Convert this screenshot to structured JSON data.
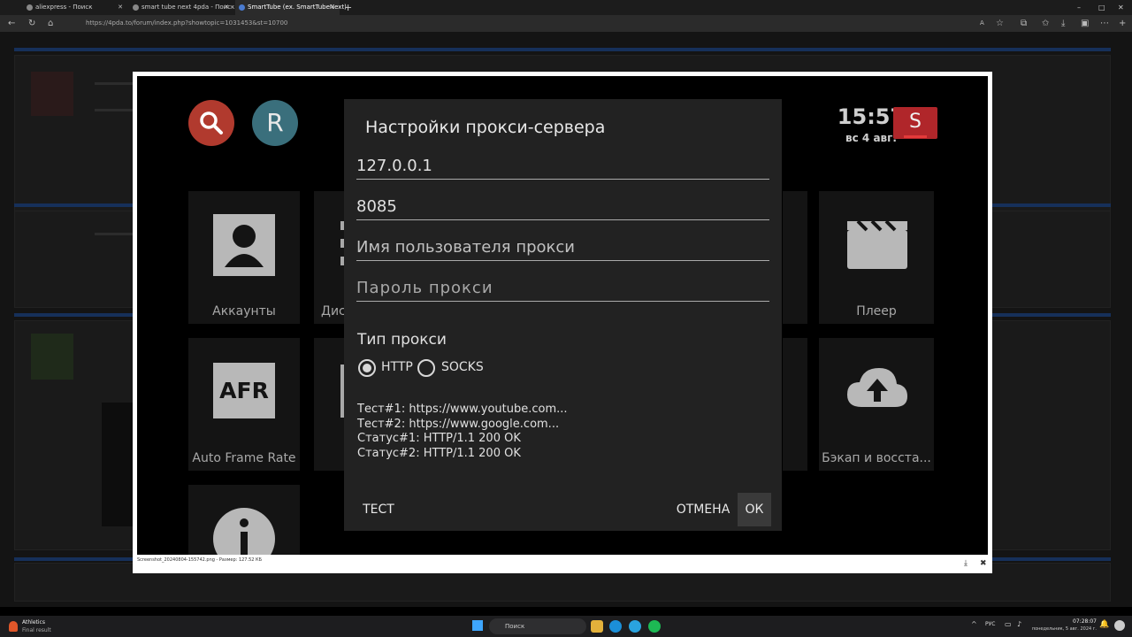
{
  "browser": {
    "tabs": [
      {
        "label": "aliexpress - Поиск",
        "active": false
      },
      {
        "label": "smart tube next 4pda - Поиск",
        "active": false
      },
      {
        "label": "SmartTube (ex. SmartTubeNext)",
        "active": true
      }
    ],
    "new_tab": "+",
    "url": "https://4pda.to/forum/index.php?showtopic=1031453&st=10700",
    "window_controls": [
      "–",
      "□",
      "✕"
    ]
  },
  "viewer": {
    "caption": "Screenshot_20240804-155742.png - Размер: 127.52 КБ",
    "download_icon": "download-icon",
    "close_icon": "close-icon"
  },
  "tv": {
    "search_icon": "search-icon",
    "avatar_letter": "R",
    "time": "15:57",
    "date": "вс 4 авг.",
    "logo_letter": "S",
    "tiles": [
      {
        "label": "Аккаунты",
        "icon": "account-icon"
      },
      {
        "label": "Дис",
        "icon": "list-icon"
      },
      {
        "label": "Плеер",
        "icon": "clapperboard-icon"
      },
      {
        "label": "Auto Frame Rate",
        "icon": "afr-icon"
      },
      {
        "label": "Бэкап и восста...",
        "icon": "cloud-upload-icon"
      },
      {
        "label": "",
        "icon": "info-icon"
      }
    ],
    "afr_text": "AFR"
  },
  "dialog": {
    "title": "Настройки прокси-сервера",
    "host_value": "127.0.0.1",
    "port_value": "8085",
    "username_placeholder": "Имя пользователя прокси",
    "password_placeholder": "Пароль прокси",
    "type_label": "Тип прокси",
    "types": [
      {
        "label": "HTTP",
        "selected": true
      },
      {
        "label": "SOCKS",
        "selected": false
      }
    ],
    "status_lines": [
      "Тест#1: https://www.youtube.com...",
      "Тест#2: https://www.google.com...",
      "Статус#1: HTTP/1.1 200 OK",
      "Статус#2: HTTP/1.1 200 OK"
    ],
    "test_button": "ТЕСТ",
    "cancel_button": "ОТМЕНА",
    "ok_button": "ОК"
  },
  "taskbar": {
    "weather_title": "Athletics",
    "weather_sub": "Final result",
    "search_placeholder": "Поиск",
    "language": "РУС",
    "time": "07:28:07",
    "date": "понедельник, 5 авг. 2024 г."
  },
  "colors": {
    "search_circle": "#b13a2e",
    "avatar_circle": "#3a6f7c",
    "logo": "#b0262a",
    "dialog_bg": "#222222",
    "forum_band": "#16305a"
  }
}
